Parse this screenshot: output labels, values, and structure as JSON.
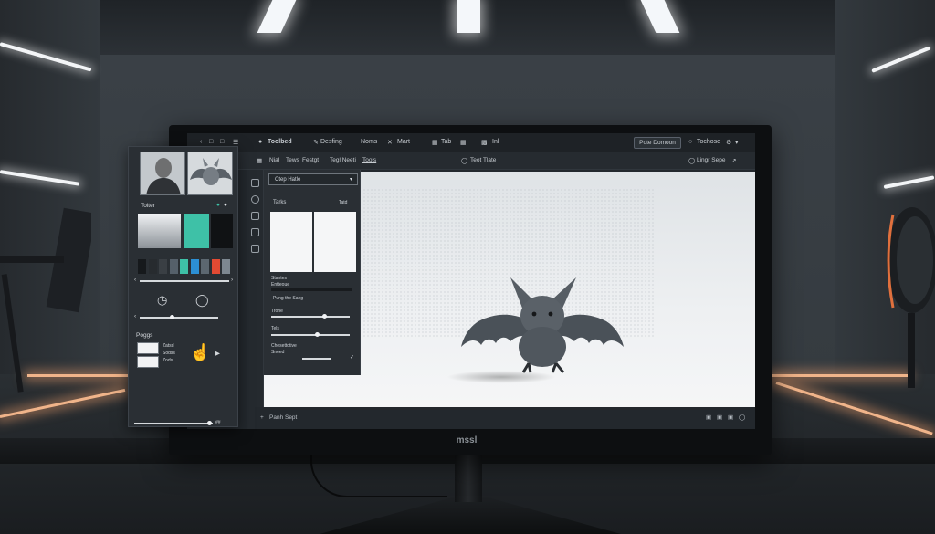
{
  "monitor": {
    "brand": "mssl"
  },
  "topbar": {
    "nav_icons": [
      "back-icon",
      "forward-icon",
      "window-icon",
      "menu-icon"
    ],
    "app_title": "Toolbed",
    "items": [
      "Desfing",
      "Noms",
      "Mart",
      "Tab",
      "Inl"
    ],
    "action_button": "Pote Domoon",
    "account": "Tochose"
  },
  "menubar": {
    "items": [
      "Nial",
      "Tews",
      "Festgt",
      "Tegl Neeti",
      "Tools"
    ],
    "center": "Teot Tlate",
    "right": "Lingr Sepe"
  },
  "float_panel": {
    "section_label": "Tolter",
    "pages_label": "Poggs",
    "page_rows": [
      "Zatsd",
      "Sodss",
      "Zods"
    ],
    "colors": {
      "swatches": [
        "#16191c",
        "#272b2f",
        "#3a3f44",
        "#55606a",
        "#3ec1a7",
        "#2c8fd3",
        "#5c6770",
        "#e24a33",
        "#7d8790"
      ]
    },
    "slider_value": "##"
  },
  "props_panel": {
    "dropdown": "Ctep Hatle",
    "tasks_label": "Tarks",
    "tasks_badge": "Tatd",
    "sections": [
      "Stantes",
      "Trone",
      "Tels",
      "Chesettotive"
    ],
    "source_label": "Entteoue",
    "note": "Pung the Saeg",
    "sub_label": "Sneed"
  },
  "statusbar": {
    "left": "Panh Sept"
  }
}
